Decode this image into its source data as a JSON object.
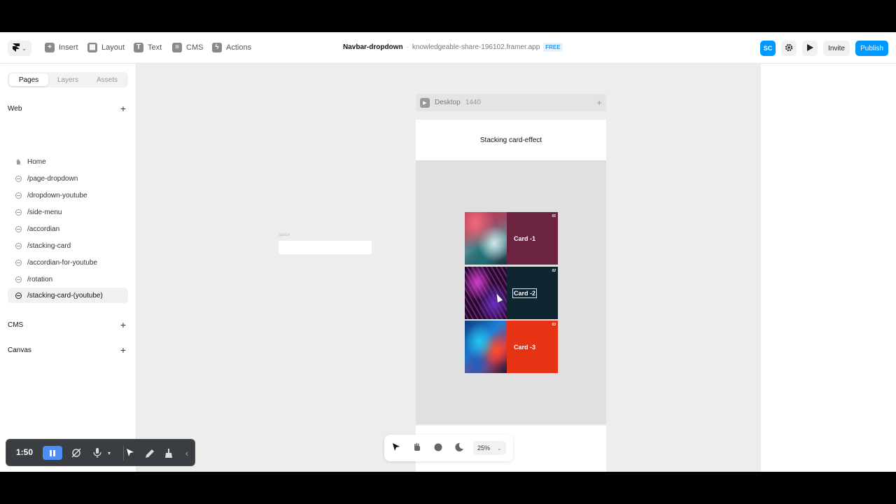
{
  "toolbar": {
    "logo_icon": "framer-logo-icon",
    "logo_chevron": "⌄",
    "items": [
      {
        "label": "Insert",
        "icon": "+"
      },
      {
        "label": "Layout",
        "icon": "▦"
      },
      {
        "label": "Text",
        "icon": "T"
      },
      {
        "label": "CMS",
        "icon": "≡"
      },
      {
        "label": "Actions",
        "icon": "ϟ"
      }
    ],
    "project_name": "Navbar-dropdown",
    "separator": "·",
    "project_url": "knowledgeable-share-196102.framer.app",
    "plan_badge": "FREE",
    "avatar_initials": "SC",
    "invite_label": "Invite",
    "publish_label": "Publish",
    "accent_color": "#0099ff"
  },
  "left_panel": {
    "tabs": [
      "Pages",
      "Layers",
      "Assets"
    ],
    "active_tab": "Pages",
    "web_section": "Web",
    "pages": [
      {
        "label": "Home",
        "icon": "home-icon"
      },
      {
        "label": "/page-dropdown",
        "icon": "globe-icon"
      },
      {
        "label": "/dropdown-youtube",
        "icon": "globe-icon"
      },
      {
        "label": "/side-menu",
        "icon": "globe-icon"
      },
      {
        "label": "/accordian",
        "icon": "globe-icon"
      },
      {
        "label": "/stacking-card",
        "icon": "globe-icon"
      },
      {
        "label": "/accordian-for-youtube",
        "icon": "globe-icon"
      },
      {
        "label": "/rotation",
        "icon": "globe-icon"
      },
      {
        "label": "/stacking-card-(youtube)",
        "icon": "globe-icon",
        "active": true
      }
    ],
    "cms_section": "CMS",
    "canvas_section": "Canvas",
    "add_symbol": "+"
  },
  "canvas": {
    "space_label": "space",
    "frame_name": "Desktop",
    "frame_width": "1440",
    "frame_plus": "+",
    "frame_heading": "Stacking card-effect",
    "cards": [
      {
        "label": "Card -1",
        "number": "01",
        "color": "#6b2340"
      },
      {
        "label": "Card -2",
        "number": "02",
        "color": "#0f2530"
      },
      {
        "label": "Card -3",
        "number": "03",
        "color": "#e63314"
      }
    ]
  },
  "bottom_toolbar": {
    "tools": [
      "pointer-icon",
      "hand-icon",
      "comment-icon",
      "moon-icon"
    ],
    "zoom": "25%",
    "zoom_chevron": "⌄"
  },
  "recorder": {
    "time": "1:50",
    "icons": [
      "pause-icon",
      "camera-off-icon",
      "mic-icon",
      "pointer-icon",
      "pen-icon",
      "broom-icon",
      "collapse-icon"
    ]
  }
}
